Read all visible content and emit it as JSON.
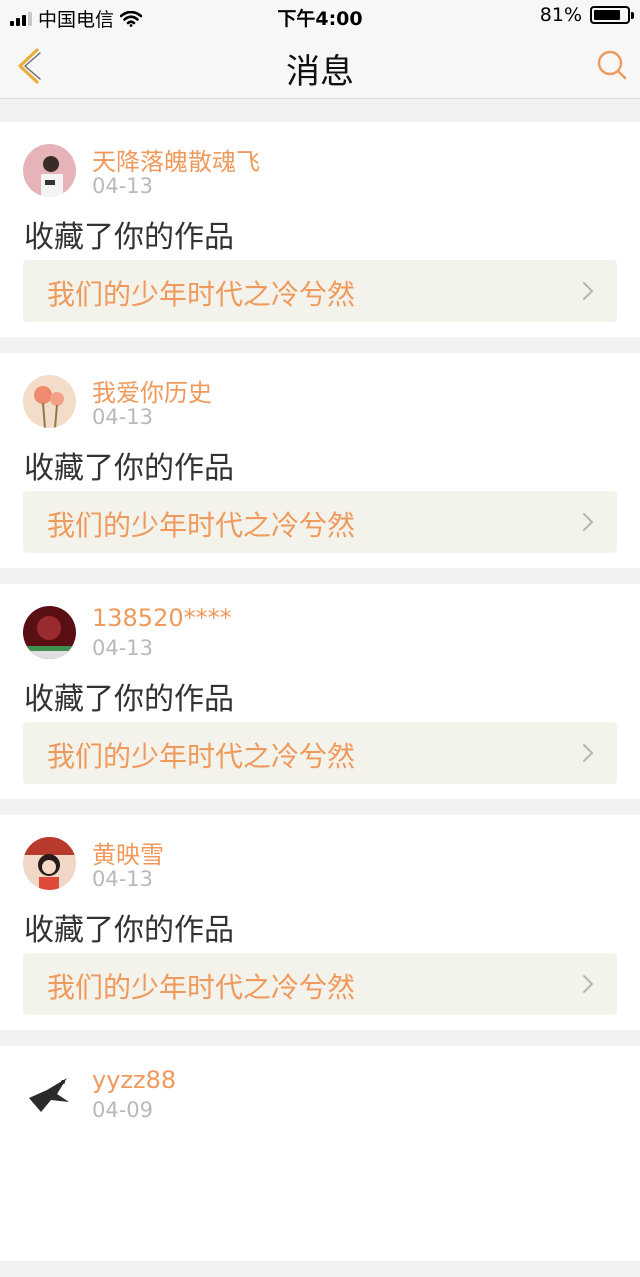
{
  "status_bar": {
    "carrier": "中国电信",
    "time": "下午4:00",
    "battery": "81%",
    "battery_level": 0.81
  },
  "nav": {
    "title": "消息",
    "back_icon": "chevron-left-icon",
    "search_icon": "search-icon"
  },
  "colors": {
    "accent": "#ef9a5c",
    "date": "#b9b9b9",
    "link_bg": "#f3f3ec"
  },
  "messages": [
    {
      "username": "天降落魄散魂飞",
      "date": "04-13",
      "action": "收藏了你的作品",
      "work_title": "我们的少年时代之冷兮然"
    },
    {
      "username": "我爱你历史",
      "date": "04-13",
      "action": "收藏了你的作品",
      "work_title": "我们的少年时代之冷兮然"
    },
    {
      "username": "138520****",
      "date": "04-13",
      "action": "收藏了你的作品",
      "work_title": "我们的少年时代之冷兮然"
    },
    {
      "username": "黄映雪",
      "date": "04-13",
      "action": "收藏了你的作品",
      "work_title": "我们的少年时代之冷兮然"
    },
    {
      "username": "yyzz88",
      "date": "04-09"
    }
  ]
}
